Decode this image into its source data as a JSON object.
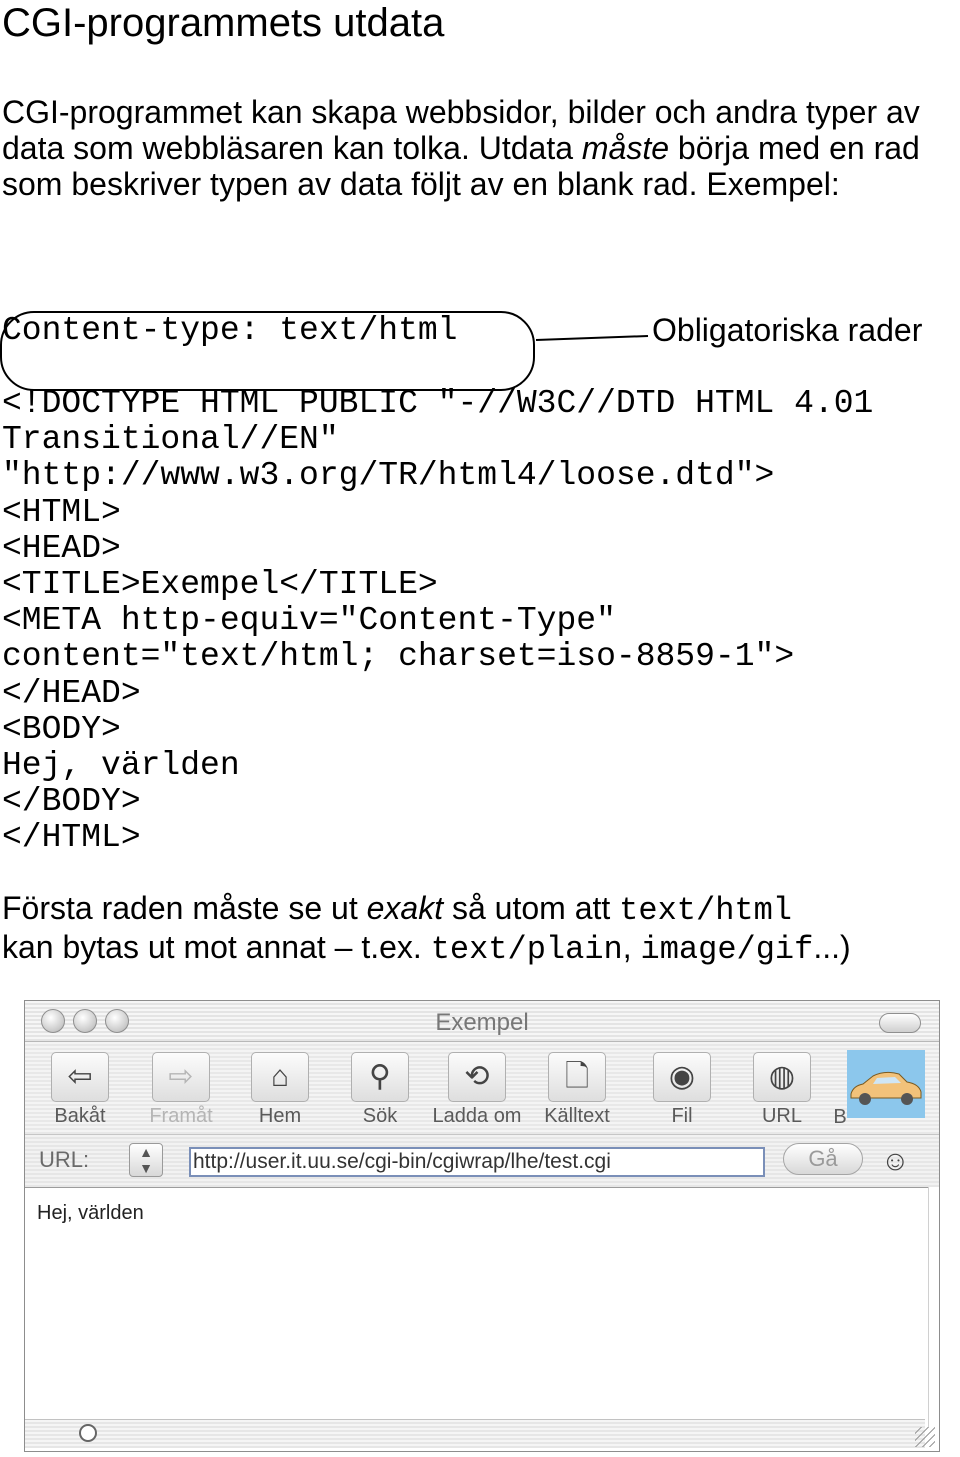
{
  "slide": {
    "title": "CGI-programmets utdata",
    "intro": {
      "part1": "CGI-programmet kan skapa webbsidor, bilder och andra typer av data som webbläsaren kan tolka. Utdata ",
      "emphasis": "måste",
      "part2": " börja med en rad som beskriver typen av data följt av en blank rad. Exempel:"
    },
    "content_type_line": "Content-type: text/html",
    "annotation": "Obligatoriska rader",
    "code_lines": [
      "<!DOCTYPE HTML PUBLIC \"-//W3C//DTD HTML 4.01",
      "Transitional//EN\"",
      "\"http://www.w3.org/TR/html4/loose.dtd\">",
      "<HTML>",
      "<HEAD>",
      "<TITLE>Exempel</TITLE>",
      "<META http-equiv=\"Content-Type\"",
      "content=\"text/html; charset=iso-8859-1\">",
      "</HEAD>",
      "<BODY>",
      "Hej, världen",
      "</BODY>",
      "</HTML>"
    ],
    "outro": {
      "t1": "Första raden måste se ut ",
      "emphasis": "exakt",
      "t2": " så utom att ",
      "code1": "text/html",
      "t3": "kan bytas ut mot annat – t.ex. ",
      "code2": "text/plain",
      "t4": ", ",
      "code3": "image/gif",
      "t5": "...)"
    }
  },
  "browser": {
    "window_title": "Exempel",
    "toolbar": [
      {
        "label": "Bakåt",
        "icon": "back-arrow-icon",
        "enabled": true
      },
      {
        "label": "Framåt",
        "icon": "forward-arrow-icon",
        "enabled": false
      },
      {
        "label": "Hem",
        "icon": "home-icon",
        "enabled": true
      },
      {
        "label": "Sök",
        "icon": "magnifier-icon",
        "enabled": true
      },
      {
        "label": "Ladda om",
        "icon": "reload-icon",
        "enabled": true
      },
      {
        "label": "Källtext",
        "icon": "document-icon",
        "enabled": true
      },
      {
        "label": "Fil",
        "icon": "disc-icon",
        "enabled": true
      },
      {
        "label": "URL",
        "icon": "globe-icon",
        "enabled": true
      },
      {
        "label": "B",
        "icon": "",
        "enabled": true
      }
    ],
    "url_label": "URL:",
    "url_value": "http://user.it.uu.se/cgi-bin/cgiwrap/lhe/test.cgi",
    "go_label": "Gå",
    "page_text": "Hej, världen",
    "colors": {
      "car_background": "#8cc7ec",
      "car": "#f2c27a",
      "url_border": "#7a8fb8"
    }
  }
}
